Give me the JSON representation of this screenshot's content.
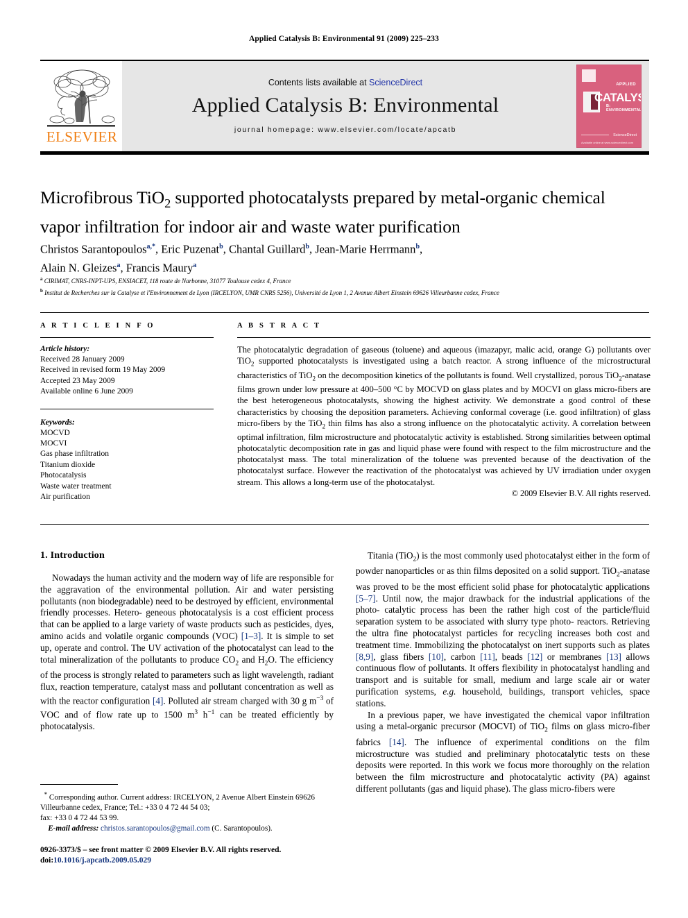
{
  "running_head": "Applied Catalysis B: Environmental 91 (2009) 225–233",
  "masthead": {
    "publisher": "ELSEVIER",
    "contents_prefix": "Contents lists available at ",
    "sciencedirect": "ScienceDirect",
    "journal_title": "Applied Catalysis B: Environmental",
    "homepage": "journal homepage: www.elsevier.com/locate/apcatb",
    "cover": {
      "applied_label": "APPLIED",
      "main_word": "CATALYSIS",
      "sub_label": "B: ENVIRONMENTAL",
      "sciencedirect_label": "ScienceDirect",
      "footer_label": "Available online at www.sciencedirect.com",
      "color": "#d9617e"
    }
  },
  "article": {
    "title_line1": "Microfibrous TiO2 supported photocatalysts prepared by metal-organic chemical",
    "title_line2": "vapor infiltration for indoor air and waste water purification",
    "authors_line1": "Christos Sarantopoulos a,*, Eric Puzenat b, Chantal Guillard b, Jean-Marie Herrmann b,",
    "authors_line2": "Alain N. Gleizes a, Francis Maury a",
    "affiliation_a": "CIRIMAT, CNRS-INPT-UPS, ENSIACET, 118 route de Narbonne, 31077 Toulouse cedex 4, France",
    "affiliation_b": "Institut de Recherches sur la Catalyse et l'Environnement de Lyon (IRCELYON, UMR CNRS 5256), Université de Lyon 1, 2 Avenue Albert Einstein 69626 Villeurbanne cedex, France"
  },
  "article_info": {
    "heading": "A R T I C L E   I N F O",
    "history_label": "Article history:",
    "history": [
      "Received 28 January 2009",
      "Received in revised form 19 May 2009",
      "Accepted 23 May 2009",
      "Available online 6 June 2009"
    ],
    "keywords_label": "Keywords:",
    "keywords": [
      "MOCVD",
      "MOCVI",
      "Gas phase infiltration",
      "Titanium dioxide",
      "Photocatalysis",
      "Waste water treatment",
      "Air purification"
    ]
  },
  "abstract": {
    "heading": "A B S T R A C T",
    "text": "The photocatalytic degradation of gaseous (toluene) and aqueous (imazapyr, malic acid, orange G) pollutants over TiO2 supported photocatalysts is investigated using a batch reactor. A strong influence of the microstructural characteristics of TiO2 on the decomposition kinetics of the pollutants is found. Well crystallized, porous TiO2-anatase films grown under low pressure at 400–500 °C by MOCVD on glass plates and by MOCVI on glass micro-fibers are the best heterogeneous photocatalysts, showing the highest activity. We demonstrate a good control of these characteristics by choosing the deposition parameters. Achieving conformal coverage (i.e. good infiltration) of glass micro-fibers by the TiO2 thin films has also a strong influence on the photocatalytic activity. A correlation between optimal infiltration, film microstructure and photocatalytic activity is established. Strong similarities between optimal photocatalytic decomposition rate in gas and liquid phase were found with respect to the film microstructure and the photocatalyst mass. The total mineralization of the toluene was prevented because of the deactivation of the photocatalyst surface. However the reactivation of the photocatalyst was achieved by UV irradiation under oxygen stream. This allows a long-term use of the photocatalyst.",
    "copyright": "© 2009 Elsevier B.V. All rights reserved."
  },
  "introduction": {
    "heading": "1. Introduction",
    "left_para1": "Nowadays the human activity and the modern way of life are responsible for the aggravation of the environmental pollution. Air and water persisting pollutants (non biodegradable) need to be destroyed by efficient, environmental friendly processes. Heterogeneous photocatalysis is a cost efficient process that can be applied to a large variety of waste products such as pesticides, dyes, amino acids and volatile organic compounds (VOC) [1–3]. It is simple to set up, operate and control. The UV activation of the photocatalyst can lead to the total mineralization of the pollutants to produce CO2 and H2O. The efficiency of the process is strongly related to parameters such as light wavelength, radiant flux, reaction temperature, catalyst mass and pollutant concentration as well as with the reactor configuration [4]. Polluted air stream charged with 30 g m−3 of VOC and of flow rate up to 1500 m3 h−1 can be treated efficiently by photocatalysis.",
    "right_para1": "Titania (TiO2) is the most commonly used photocatalyst either in the form of powder nanoparticles or as thin films deposited on a solid support. TiO2-anatase was proved to be the most efficient solid phase for photocatalytic applications [5–7]. Until now, the major drawback for the industrial applications of the photocatalytic process has been the rather high cost of the particle/fluid separation system to be associated with slurry type photoreactors. Retrieving the ultra fine photocatalyst particles for recycling increases both cost and treatment time. Immobilizing the photocatalyst on inert supports such as plates [8,9], glass fibers [10], carbon [11], beads [12] or membranes [13] allows continuous flow of pollutants. It offers flexibility in photocatalyst handling and transport and is suitable for small, medium and large scale air or water purification systems, e.g. household, buildings, transport vehicles, space stations.",
    "right_para2": "In a previous paper, we have investigated the chemical vapor infiltration using a metal-organic precursor (MOCVI) of TiO2 films on glass micro-fiber fabrics [14]. The influence of experimental conditions on the film microstructure was studied and preliminary photocatalytic tests on these deposits were reported. In this work we focus more thoroughly on the relation between the film microstructure and photocatalytic activity (PA) against different pollutants (gas and liquid phase). The glass micro-fibers were"
  },
  "footnote": {
    "line1": "* Corresponding author. Current address: IRCELYON, 2 Avenue Albert Einstein",
    "line2": "69626 Villeurbanne cedex, France; Tel.: +33 0 4 72 44 54 03;",
    "line3": "fax: +33 0 4 72 44 53 99.",
    "email_label": "E-mail address:",
    "email": "christos.sarantopoulos@gmail.com",
    "email_owner": "(C. Sarantopoulos)."
  },
  "imprint": {
    "line1": "0926-3373/$ – see front matter © 2009 Elsevier B.V. All rights reserved.",
    "doi_label": "doi:",
    "doi": "10.1016/j.apcatb.2009.05.029"
  }
}
